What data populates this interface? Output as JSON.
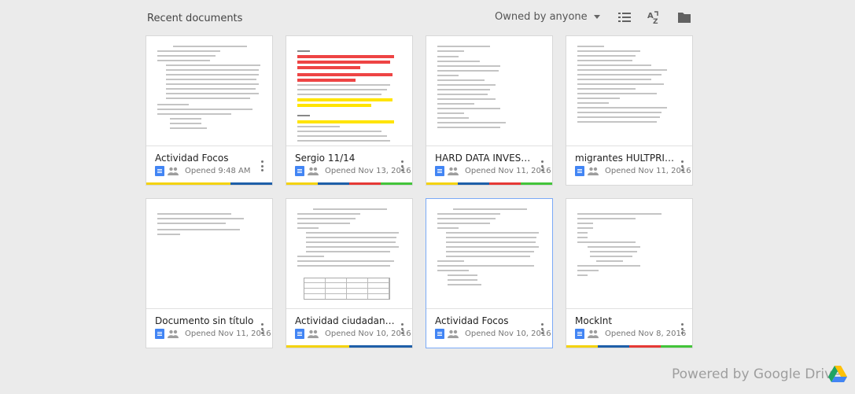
{
  "header": {
    "title": "Recent documents",
    "owner_filter": "Owned by anyone"
  },
  "toolbar": {
    "icons": [
      "list-view-icon",
      "sort-az-icon",
      "folder-icon"
    ]
  },
  "documents": [
    {
      "title": "Actividad Focos",
      "opened": "Opened 9:48 AM",
      "colors": [
        "#f4d30f",
        "#f4d30f",
        "#1e5fa8"
      ]
    },
    {
      "title": "Sergio 11/14",
      "opened": "Opened Nov 13, 2016",
      "colors": [
        "#f4d30f",
        "#1e5fa8",
        "#e53935",
        "#43c43a"
      ]
    },
    {
      "title": "HARD DATA INVESTIGAT...",
      "opened": "Opened Nov 11, 2016",
      "colors": [
        "#f4d30f",
        "#1e5fa8",
        "#e53935",
        "#43c43a"
      ]
    },
    {
      "title": "migrantes HULTPRIZE",
      "opened": "Opened Nov 11, 2016",
      "colors": []
    },
    {
      "title": "Documento sin título",
      "opened": "Opened Nov 11, 2016",
      "colors": []
    },
    {
      "title": "Actividad ciudadana para...",
      "opened": "Opened Nov 10, 2016",
      "colors": [
        "#f4d30f",
        "#1e5fa8"
      ]
    },
    {
      "title": "Actividad Focos",
      "opened": "Opened Nov 10, 2016",
      "colors": []
    },
    {
      "title": "MockInt",
      "opened": "Opened Nov 8, 2016",
      "colors": [
        "#f4d30f",
        "#1e5fa8",
        "#e53935",
        "#43c43a"
      ]
    }
  ],
  "footer": {
    "powered_by": "Powered by Google Drive"
  },
  "theme": {
    "doc_icon_color": "#4285f4",
    "selected_border": "#7baaf7"
  }
}
